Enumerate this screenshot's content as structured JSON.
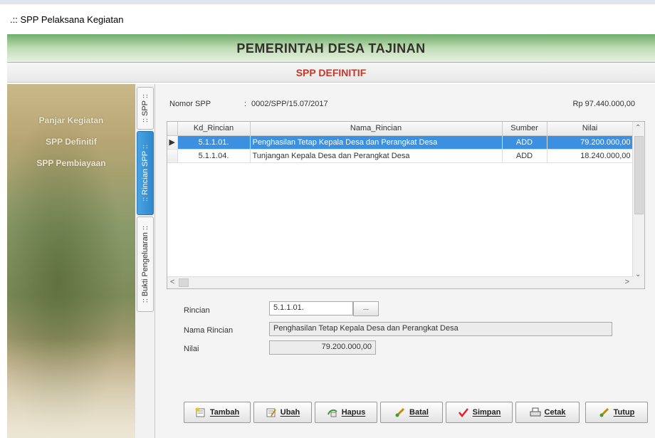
{
  "window": {
    "title": ".:: SPP Pelaksana Kegiatan"
  },
  "header": {
    "title": "PEMERINTAH DESA TAJINAN",
    "subtitle": "SPP DEFINITIF"
  },
  "sidebar": {
    "items": [
      {
        "label": "Panjar Kegiatan"
      },
      {
        "label": "SPP Definitif"
      },
      {
        "label": "SPP Pembiayaan"
      }
    ]
  },
  "tabs": [
    {
      "label": ":: SPP ::"
    },
    {
      "label": ":: Rincian SPP ::"
    },
    {
      "label": ":: Bukti Pengeluaran ::"
    }
  ],
  "spp": {
    "nomor_label": "Nomor SPP",
    "colon": ":",
    "nomor_value": "0002/SPP/15.07/2017",
    "total": "Rp 97.440.000,00"
  },
  "grid": {
    "columns": [
      "Kd_Rincian",
      "Nama_Rincian",
      "Sumber",
      "Nilai"
    ],
    "rows": [
      {
        "kd": "5.1.1.01.",
        "nama": "Penghasilan Tetap Kepala Desa dan Perangkat Desa",
        "sumber": "ADD",
        "nilai": "79.200.000,00"
      },
      {
        "kd": "5.1.1.04.",
        "nama": "Tunjangan Kepala Desa dan Perangkat Desa",
        "sumber": "ADD",
        "nilai": "18.240.000,00"
      }
    ]
  },
  "form": {
    "rincian_label": "Rincian",
    "rincian_value": "5.1.1.01.",
    "lookup": "...",
    "nama_label": "Nama Rincian",
    "nama_value": "Penghasilan Tetap Kepala Desa dan Perangkat Desa",
    "nilai_label": "Nilai",
    "nilai_value": "79.200.000,00"
  },
  "buttons": {
    "tambah": "Tambah",
    "ubah": "Ubah",
    "hapus": "Hapus",
    "batal": "Batal",
    "simpan": "Simpan",
    "cetak": "Cetak",
    "tutup": "Tutup"
  },
  "colors": {
    "accent": "#3d8fe0",
    "header_green": "#6fae6a",
    "subtitle_red": "#c0392b"
  }
}
